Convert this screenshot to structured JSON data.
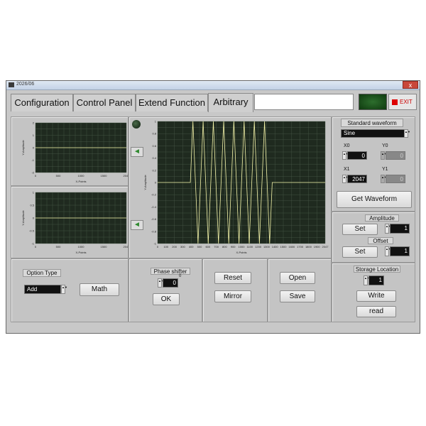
{
  "window": {
    "title": "2026/06",
    "close_glyph": "x"
  },
  "tabs": [
    {
      "label": "Configuration"
    },
    {
      "label": "Control Panel"
    },
    {
      "label": "Extend Function"
    },
    {
      "label": "Arbitrary",
      "active": true
    }
  ],
  "exit_label": "EXIT",
  "graphs": {
    "small_top": {
      "xlabel": "X-Points",
      "ylabel": "Y-Amplitude",
      "x_ticks": [
        "0",
        "500",
        "1000",
        "1500",
        "2047"
      ],
      "y_ticks": [
        "2",
        "1",
        "0",
        "-1",
        "-2"
      ]
    },
    "small_bottom": {
      "xlabel": "X-Points",
      "ylabel": "Y-Amplitude",
      "x_ticks": [
        "0",
        "500",
        "1000",
        "1500",
        "2047"
      ],
      "y_ticks": [
        "1",
        "0.5",
        "0",
        "-0.5",
        "-1"
      ]
    },
    "main": {
      "xlabel": "X-Points",
      "ylabel": "Y-Amplitude",
      "x_ticks": [
        "0",
        "100",
        "200",
        "300",
        "400",
        "500",
        "600",
        "700",
        "800",
        "900",
        "1000",
        "1100",
        "1200",
        "1300",
        "1400",
        "1500",
        "1600",
        "1700",
        "1800",
        "1900",
        "2047"
      ],
      "y_ticks": [
        "1",
        "0.8",
        "0.6",
        "0.4",
        "0.2",
        "0",
        "-0.2",
        "-0.4",
        "-0.6",
        "-0.8",
        "-1"
      ]
    }
  },
  "chart_data": {
    "type": "line",
    "xlabel": "X-Points",
    "ylabel": "Y-Amplitude",
    "xlim": [
      0,
      2047
    ],
    "ylim": [
      -1,
      1
    ],
    "series": [
      {
        "x": [
          0,
          400,
          1400,
          2047
        ],
        "segment_type": [
          "flat",
          "sine",
          "flat"
        ],
        "cycles": 8,
        "y_flat": 0
      }
    ]
  },
  "arrow_glyph": "◄",
  "standard_waveform": {
    "label": "Standard waveform",
    "selected": "Sine",
    "x0": {
      "label": "X0",
      "value": "0"
    },
    "y0": {
      "label": "Y0",
      "value": "0"
    },
    "x1": {
      "label": "X1",
      "value": "2047"
    },
    "y1": {
      "label": "Y1",
      "value": "0"
    },
    "get_button": "Get Waveform"
  },
  "amplitude": {
    "label": "Amplitude",
    "set": "Set",
    "value": "1"
  },
  "offset": {
    "label": "Offset",
    "set": "Set",
    "value": "1"
  },
  "storage": {
    "label": "Storage Location",
    "value": "1",
    "write": "Write",
    "read": "read"
  },
  "option": {
    "label": "Option Type",
    "selected": "Add",
    "math": "Math"
  },
  "phase": {
    "label": "Phase shifter",
    "unit": "0",
    "value": "0",
    "ok": "OK"
  },
  "edit": {
    "reset": "Reset",
    "mirror": "Mirror"
  },
  "file": {
    "open": "Open",
    "save": "Save"
  },
  "colors": {
    "graph_bg": "#1f2a1f",
    "trace": "#f3f3a8",
    "grid": "#4a5a4a",
    "panel": "#c4c4c4"
  }
}
